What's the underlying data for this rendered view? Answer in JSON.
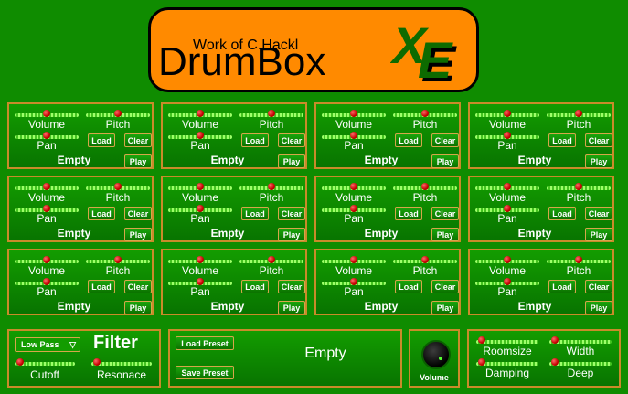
{
  "logo": {
    "credit": "Work of C.Hackl",
    "title": "DrumBox",
    "suffix": "XE"
  },
  "pad": {
    "volume_label": "Volume",
    "pitch_label": "Pitch",
    "pan_label": "Pan",
    "load_label": "Load",
    "clear_label": "Clear",
    "play_label": "Play",
    "sample_name": "Empty"
  },
  "pads": [
    {
      "sample": "Empty"
    },
    {
      "sample": "Empty"
    },
    {
      "sample": "Empty"
    },
    {
      "sample": "Empty"
    },
    {
      "sample": "Empty"
    },
    {
      "sample": "Empty"
    },
    {
      "sample": "Empty"
    },
    {
      "sample": "Empty"
    },
    {
      "sample": "Empty"
    },
    {
      "sample": "Empty"
    },
    {
      "sample": "Empty"
    },
    {
      "sample": "Empty"
    }
  ],
  "filter": {
    "type_selected": "Low Pass",
    "title": "Filter",
    "cutoff_label": "Cutoff",
    "resonance_label": "Resonace"
  },
  "preset": {
    "load_label": "Load Preset",
    "save_label": "Save Preset",
    "name": "Empty"
  },
  "master": {
    "volume_label": "Volume"
  },
  "reverb": {
    "roomsize_label": "Roomsize",
    "width_label": "Width",
    "damping_label": "Damping",
    "deep_label": "Deep"
  },
  "colors": {
    "background": "#0f8c00",
    "border": "#c98b2a",
    "logo": "#ff8a00",
    "knob": "#c40000"
  }
}
